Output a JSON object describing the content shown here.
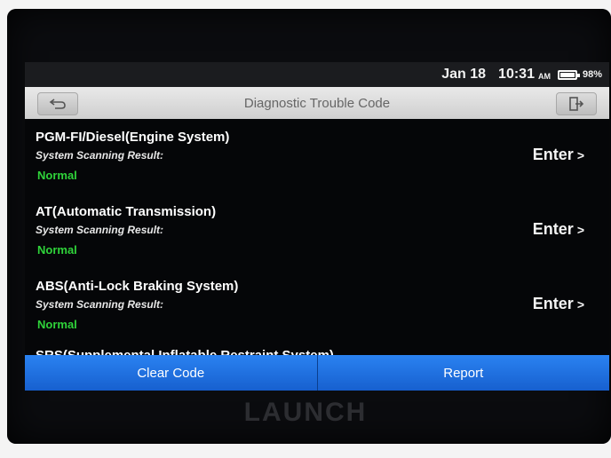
{
  "statusbar": {
    "date": "Jan 18",
    "time": "10:31",
    "ampm": "AM",
    "battery_level": 98,
    "battery_text": "98%"
  },
  "titlebar": {
    "title": "Diagnostic Trouble Code",
    "back_icon": "back-arrow-icon",
    "exit_icon": "exit-icon"
  },
  "systems": [
    {
      "name": "PGM-FI/Diesel(Engine System)",
      "scan_label": "System Scanning Result:",
      "status": "Normal",
      "enter_label": "Enter",
      "enter_icon": ">"
    },
    {
      "name": "AT(Automatic Transmission)",
      "scan_label": "System Scanning Result:",
      "status": "Normal",
      "enter_label": "Enter",
      "enter_icon": ">"
    },
    {
      "name": "ABS(Anti-Lock Braking System)",
      "scan_label": "System Scanning Result:",
      "status": "Normal",
      "enter_label": "Enter",
      "enter_icon": ">"
    }
  ],
  "partial_item": "SRS(Supplemental Inflatable Restraint System)",
  "bottombar": {
    "clear_code": "Clear Code",
    "report": "Report"
  },
  "brand": "LAUNCH",
  "colors": {
    "status_normal": "#2fd33a",
    "bottom_bar": "#1b6ee0",
    "title_bar": "#d8d8d8"
  }
}
